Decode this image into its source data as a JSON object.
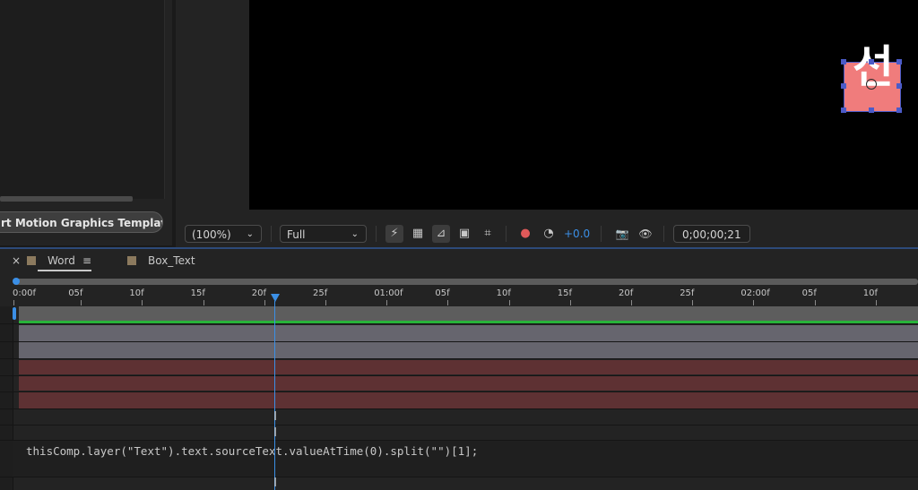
{
  "project_panel": {
    "mogrt_button_label": "rt Motion Graphics Template..."
  },
  "viewer": {
    "layer_text": "선",
    "toolbar": {
      "magnification": "(100%)",
      "resolution": "Full",
      "exposure": "+0.0",
      "timecode": "0;00;00;21",
      "chevron": "⌄",
      "icons": {
        "fast-previews": "⚡",
        "transparency-grid": "▦",
        "mask-visibility": "⊿",
        "region-of-interest": "▣",
        "title-safe": "⌗",
        "color-channel": "●",
        "reset-exposure": "◔",
        "snapshot": "📷",
        "show-snapshot": "👁"
      }
    }
  },
  "timeline": {
    "tabs": [
      {
        "close": "×",
        "label": "Word",
        "menu": "≡"
      },
      {
        "label": "Box_Text"
      }
    ],
    "ruler_labels": [
      "0:00f",
      "05f",
      "10f",
      "15f",
      "20f",
      "25f",
      "01:00f",
      "05f",
      "10f",
      "15f",
      "20f",
      "25f",
      "02:00f",
      "05f",
      "10f"
    ],
    "current_frame": 21,
    "expression": "thisComp.layer(\"Text\").text.sourceText.valueAtTime(0).split(\"\")[1];",
    "ibeam": "I"
  },
  "colors": {
    "accent": "#3b8fe6",
    "layer_fill": "#f07c7c",
    "audio_bar": "#28b33a",
    "track_red": "#5e3133",
    "track_grey": "#66656e"
  }
}
